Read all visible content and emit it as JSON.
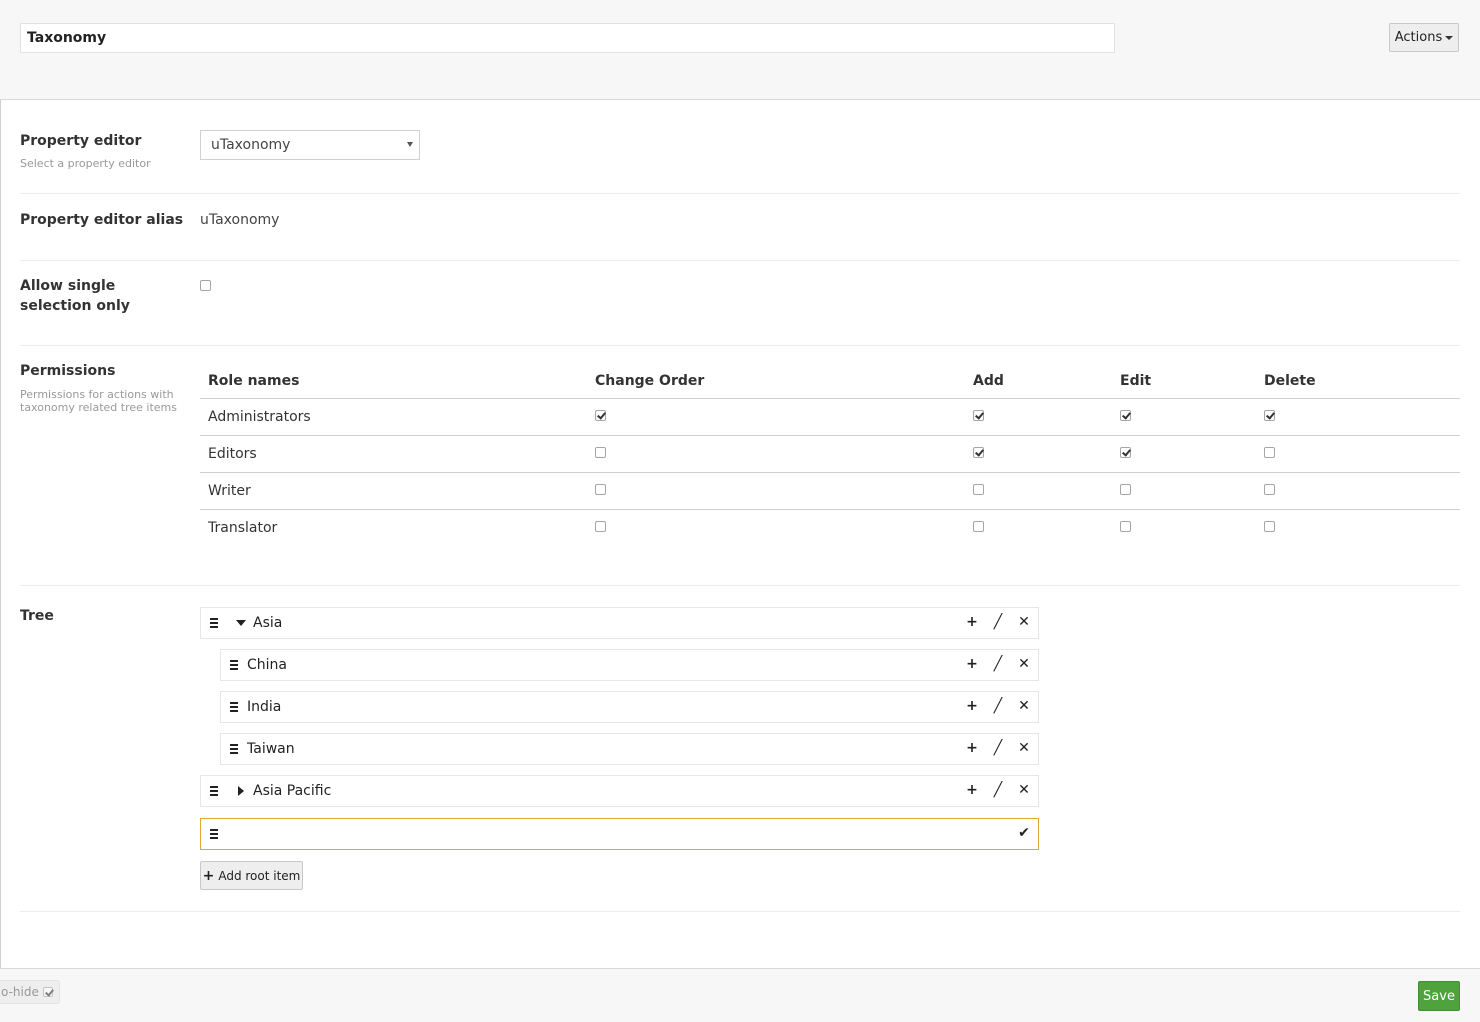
{
  "header": {
    "name_value": "Taxonomy",
    "actions_label": "Actions"
  },
  "property_editor": {
    "label": "Property editor",
    "description": "Select a property editor",
    "selected": "uTaxonomy"
  },
  "alias": {
    "label": "Property editor alias",
    "value": "uTaxonomy"
  },
  "single_selection": {
    "label": "Allow single selection only",
    "checked": false
  },
  "permissions": {
    "label": "Permissions",
    "description": "Permissions for actions with taxonomy related tree items",
    "columns": [
      "Role names",
      "Change Order",
      "Add",
      "Edit",
      "Delete"
    ],
    "rows": [
      {
        "role": "Administrators",
        "change_order": true,
        "add": true,
        "edit": true,
        "delete": true
      },
      {
        "role": "Editors",
        "change_order": false,
        "add": true,
        "edit": true,
        "delete": false
      },
      {
        "role": "Writer",
        "change_order": false,
        "add": false,
        "edit": false,
        "delete": false
      },
      {
        "role": "Translator",
        "change_order": false,
        "add": false,
        "edit": false,
        "delete": false
      }
    ]
  },
  "tree": {
    "label": "Tree",
    "items": [
      {
        "name": "Asia",
        "level": 0,
        "expanded": true
      },
      {
        "name": "China",
        "level": 1
      },
      {
        "name": "India",
        "level": 1
      },
      {
        "name": "Taiwan",
        "level": 1
      },
      {
        "name": "Asia Pacific",
        "level": 0,
        "expanded": false
      }
    ],
    "new_item_value": "",
    "add_root_label": "Add root item"
  },
  "footer": {
    "autohide_label": "o-hide",
    "save_label": "Save"
  },
  "colors": {
    "save": "#4fa33d",
    "editing_border": "#e3a733"
  }
}
